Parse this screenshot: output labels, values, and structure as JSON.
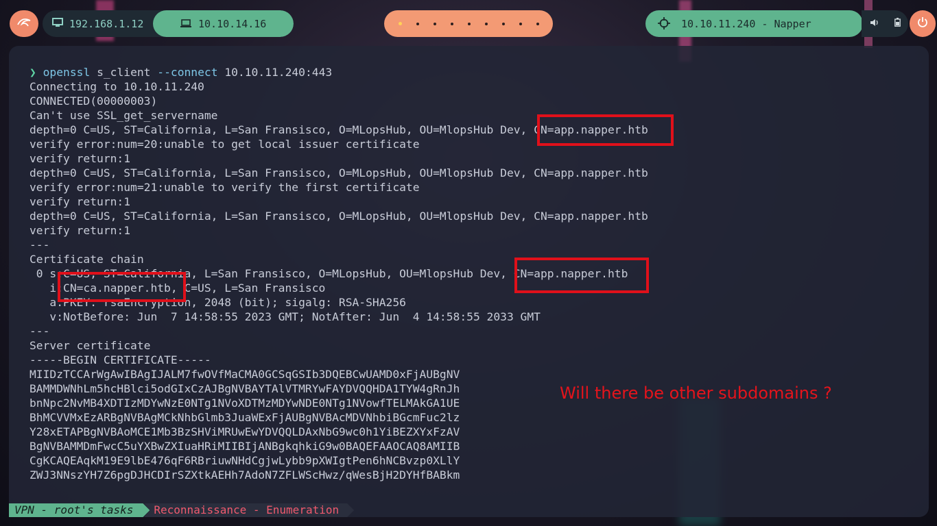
{
  "topbar": {
    "ip_local": "192.168.1.12",
    "ip_vpn": "10.10.14.16",
    "target": "10.10.11.240 - Napper",
    "workspaces": [
      "active",
      "w",
      "w",
      "w",
      "w",
      "w",
      "w",
      "w",
      "w"
    ],
    "icons": {
      "kali": "kali-dragon-icon",
      "monitor": "monitor-icon",
      "laptop": "laptop-icon",
      "target": "crosshair-icon",
      "volume": "speaker-icon",
      "battery": "battery-icon",
      "power": "power-icon"
    },
    "colors": {
      "accent_green": "#5fb48e",
      "accent_orange": "#f39a74",
      "dark": "#1f2a33"
    }
  },
  "terminal": {
    "command": {
      "prompt": "❯",
      "program": "openssl",
      "sub": "s_client",
      "flag": "--connect",
      "target": "10.10.11.240:443"
    },
    "lines": [
      "Connecting to 10.10.11.240",
      "CONNECTED(00000003)",
      "Can't use SSL_get_servername",
      "depth=0 C=US, ST=California, L=San Fransisco, O=MLopsHub, OU=MlopsHub Dev, CN=app.napper.htb",
      "verify error:num=20:unable to get local issuer certificate",
      "verify return:1",
      "depth=0 C=US, ST=California, L=San Fransisco, O=MLopsHub, OU=MlopsHub Dev, CN=app.napper.htb",
      "verify error:num=21:unable to verify the first certificate",
      "verify return:1",
      "depth=0 C=US, ST=California, L=San Fransisco, O=MLopsHub, OU=MlopsHub Dev, CN=app.napper.htb",
      "verify return:1",
      "---",
      "Certificate chain",
      " 0 s:C=US, ST=California, L=San Fransisco, O=MLopsHub, OU=MlopsHub Dev, CN=app.napper.htb",
      "   i:CN=ca.napper.htb, C=US, L=San Fransisco",
      "   a:PKEY: rsaEncryption, 2048 (bit); sigalg: RSA-SHA256",
      "   v:NotBefore: Jun  7 14:58:55 2023 GMT; NotAfter: Jun  4 14:58:55 2033 GMT",
      "---",
      "Server certificate",
      "-----BEGIN CERTIFICATE-----",
      "MIIDzTCCArWgAwIBAgIJALM7fwOVfMaCMA0GCSqGSIb3DQEBCwUAMD0xFjAUBgNV",
      "BAMMDWNhLm5hcHBlci5odGIxCzAJBgNVBAYTAlVTMRYwFAYDVQQHDA1TYW4gRnJh",
      "bnNpc2NvMB4XDTIzMDYwNzE0NTg1NVoXDTMzMDYwNDE0NTg1NVowfTELMAkGA1UE",
      "BhMCVVMxEzARBgNVBAgMCkNhbGlmb3JuaWExFjAUBgNVBAcMDVNhbiBGcmFuc2lz",
      "Y28xETAPBgNVBAoMCE1Mb3BzSHViMRUwEwYDVQQLDAxNbG9wc0h1YiBEZXYxFzAV",
      "BgNVBAMMDmFwcC5uYXBwZXIuaHRiMIIBIjANBgkqhkiG9w0BAQEFAAOCAQ8AMIIB",
      "CgKCAQEAqkM19E9lbE476qF6RBriuwNHdCgjwLybb9pXWIgtPen6hNCBvzp0XLlY",
      "ZWJ3NNszYH7Z6pgDJHCDIrSZXtkAEHh7AdoN7ZFLWScHwz/qWesBjH2DYHfBABkm"
    ],
    "annotation": "Will there be other subdomains ?"
  },
  "statusbar": {
    "session": "VPN - root's tasks",
    "window": "Reconnaissance - Enumeration"
  }
}
